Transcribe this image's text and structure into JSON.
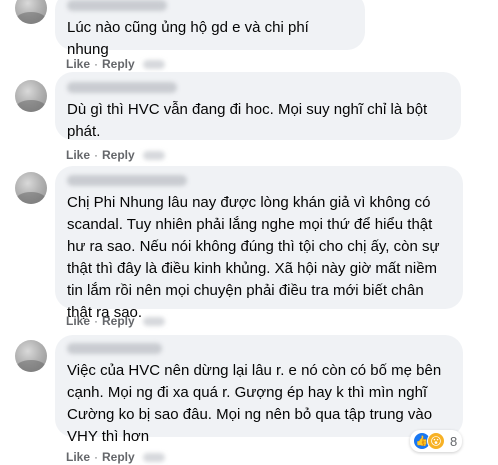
{
  "comments": [
    {
      "text": "Lúc nào cũng ủng hộ gd e và chi phí nhung",
      "actions": {
        "like": "Like",
        "dot": "·",
        "reply": "Reply"
      }
    },
    {
      "text": "Dù gì thì HVC vẫn đang đi hoc. Mọi suy nghĩ chỉ là bột phát.",
      "actions": {
        "like": "Like",
        "dot": "·",
        "reply": "Reply"
      }
    },
    {
      "text": "Chị Phi Nhung lâu nay được lòng khán giả vì không có scandal. Tuy nhiên phải lắng nghe mọi thứ để hiểu thật hư ra sao. Nếu nói không đúng thì tội cho chị ấy, còn sự thật thì đây là điều kinh khủng. Xã hội này giờ mất niềm tin lắm rồi nên mọi chuyện phải điều tra mới biết chân thật ra sao.",
      "actions": {
        "like": "Like",
        "dot": "·",
        "reply": "Reply"
      }
    },
    {
      "text": "Việc của HVC nên dừng lại lâu r. e nó còn có bố mẹ bên cạnh. Mọi ng đi xa quá r. Gượng ép hay k thì mìn nghĩ Cường ko bị sao đâu. Mọi ng nên bỏ qua tập trung vào VHY thì hơn",
      "actions": {
        "like": "Like",
        "dot": "·",
        "reply": "Reply"
      },
      "reactions": {
        "icons": [
          "like-icon",
          "wow-icon"
        ],
        "count": "8"
      }
    }
  ],
  "colors": {
    "bubble": "#f0f2f5",
    "text": "#050505",
    "action": "#65676b",
    "like": "#1877f2",
    "wow": "#f7b125"
  }
}
